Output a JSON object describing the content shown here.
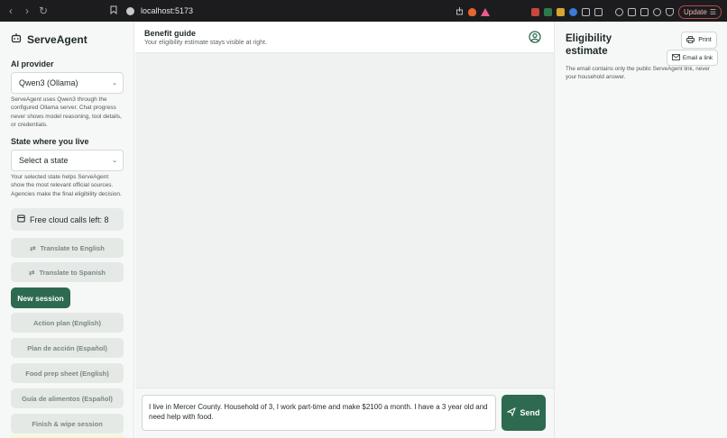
{
  "browser": {
    "url": "localhost:5173",
    "update_label": "Update"
  },
  "sidebar": {
    "brand": "ServeAgent",
    "provider_heading": "AI provider",
    "provider_selected": "Qwen3 (Ollama)",
    "provider_help": "ServeAgent uses Qwen3 through the configured Ollama server. Chat progress never shows model reasoning, tool details, or credentials.",
    "state_heading": "State where you live",
    "state_placeholder": "Select a state",
    "state_help": "Your selected state helps ServeAgent show the most relevant official sources. Agencies make the final eligibility decision.",
    "cloud_calls": "Free cloud calls left: 8",
    "translate_english": "Translate to English",
    "translate_spanish": "Translate to Spanish",
    "new_session": "New session",
    "action_plan_en": "Action plan (English)",
    "action_plan_es": "Plan de acción (Español)",
    "food_prep_en": "Food prep sheet (English)",
    "food_guide_es": "Guía de alimentos (Español)",
    "finish_wipe": "Finish & wipe session"
  },
  "main": {
    "title": "Benefit guide",
    "subtitle": "Your eligibility estimate stays visible at right.",
    "input_value": "I live in Mercer County. Household of 3, I work part-time and make $2100 a month. I have a 3 year old and need help with food.",
    "send_label": "Send"
  },
  "right_panel": {
    "title": "Eligibility estimate",
    "print_label": "Print",
    "email_label": "Email a link",
    "note": "The email contains only the public ServeAgent link, never your household answer."
  },
  "colors": {
    "primary": "#2d6a4f",
    "sidebar_bg": "#f6f8f7",
    "main_bg": "#eff2f0"
  }
}
